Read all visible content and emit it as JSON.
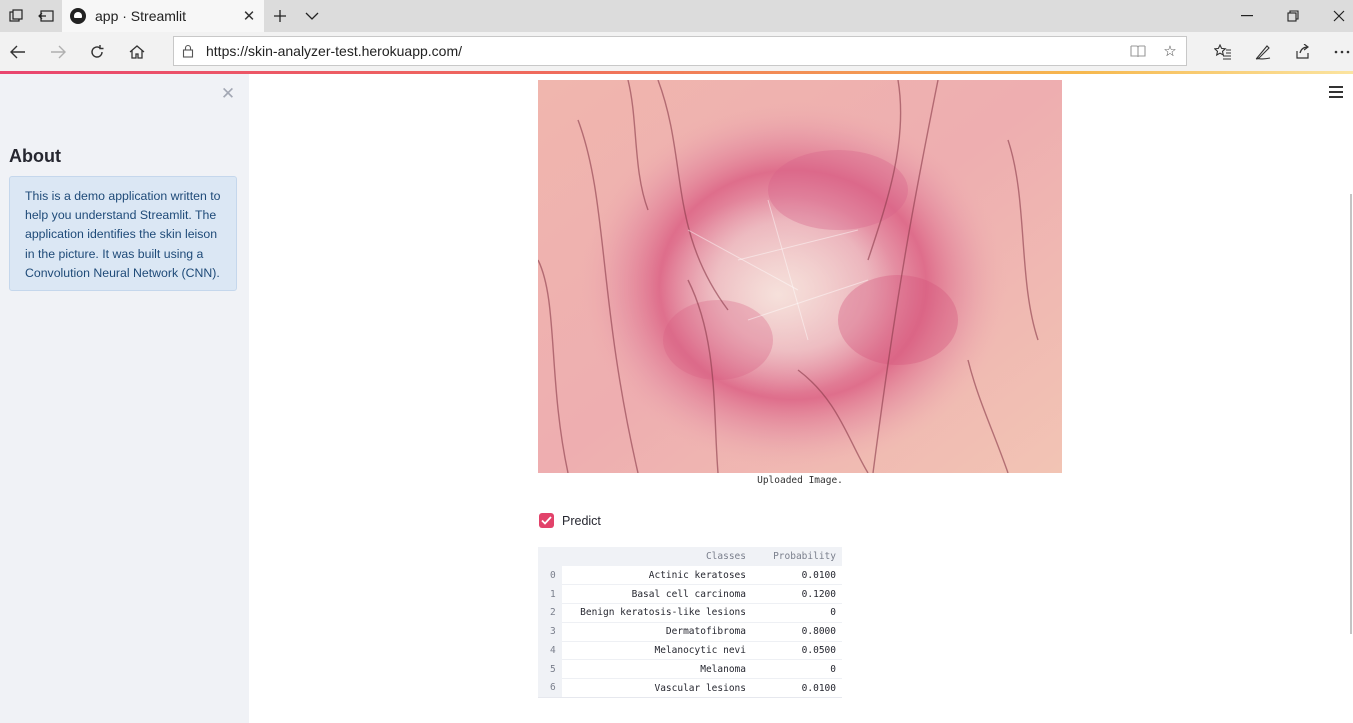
{
  "browser": {
    "tab_title": "app · Streamlit",
    "url": "https://skin-analyzer-test.herokuapp.com/"
  },
  "icons": {
    "tab_actions": [
      "tab-overview-icon",
      "set-aside-tabs-icon"
    ],
    "tab_favicon": "streamlit-logo-icon",
    "window": [
      "minimize-icon",
      "restore-icon",
      "close-icon"
    ],
    "nav": [
      "back-arrow-icon",
      "forward-arrow-icon",
      "refresh-icon",
      "home-icon",
      "lock-icon"
    ],
    "url_actions": [
      "reading-view-icon",
      "favorite-star-icon"
    ],
    "toolbar": [
      "favorites-icon",
      "pen-icon",
      "share-icon",
      "more-icon"
    ]
  },
  "sidebar": {
    "heading": "About",
    "info": "This is a demo application written to help you understand Streamlit. The application identifies the skin leison in the picture. It was built using a Convolution Neural Network (CNN)."
  },
  "main": {
    "image_caption": "Uploaded Image.",
    "predict_label": "Predict",
    "predict_checked": true,
    "table": {
      "columns": [
        "Classes",
        "Probability"
      ],
      "rows": [
        {
          "index": "0",
          "class": "Actinic keratoses",
          "probability": "0.0100"
        },
        {
          "index": "1",
          "class": "Basal cell carcinoma",
          "probability": "0.1200"
        },
        {
          "index": "2",
          "class": "Benign keratosis-like lesions",
          "probability": "0"
        },
        {
          "index": "3",
          "class": "Dermatofibroma",
          "probability": "0.8000"
        },
        {
          "index": "4",
          "class": "Melanocytic nevi",
          "probability": "0.0500"
        },
        {
          "index": "5",
          "class": "Melanoma",
          "probability": "0"
        },
        {
          "index": "6",
          "class": "Vascular lesions",
          "probability": "0.0100"
        }
      ]
    }
  },
  "colors": {
    "accent": "#e2426a",
    "sidebar_bg": "#f0f2f6",
    "info_bg": "#dbe7f4",
    "info_text": "#1e4a78"
  }
}
